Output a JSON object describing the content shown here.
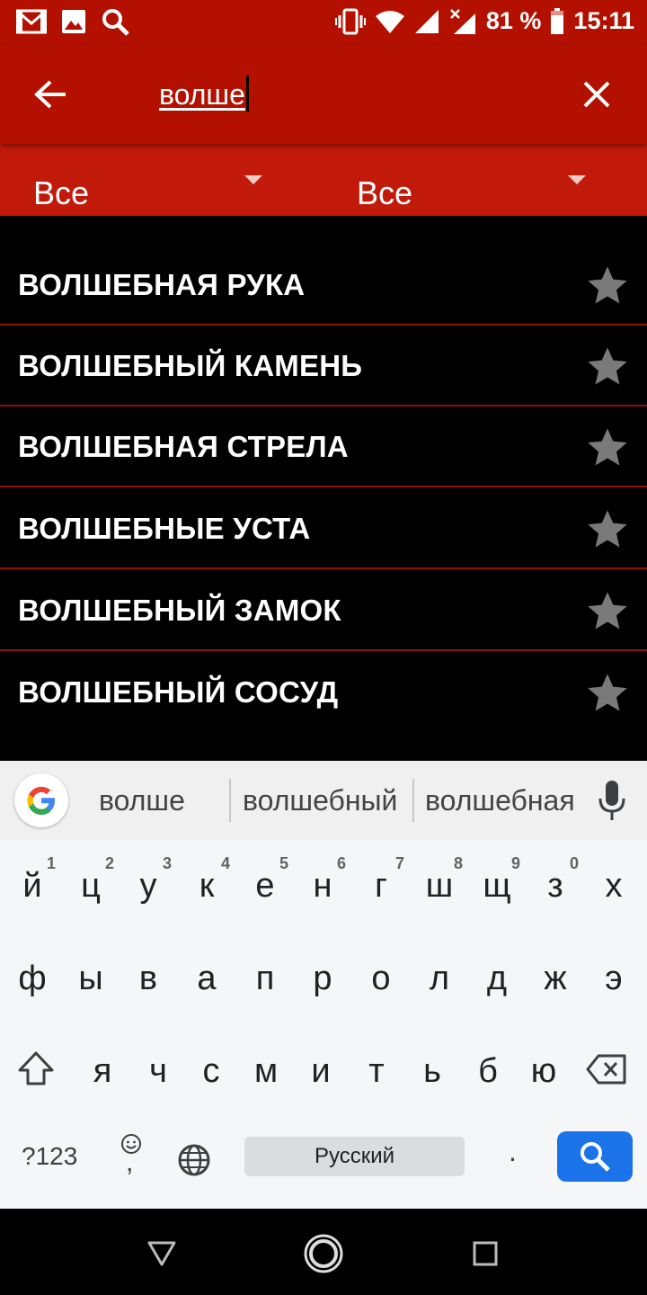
{
  "status_bar": {
    "battery": "81 %",
    "time": "15:11",
    "icons": [
      "gmail-icon",
      "gallery-icon",
      "search-icon",
      "vibrate-icon",
      "wifi-icon",
      "signal-icon",
      "signal-nodata-icon",
      "battery-icon"
    ]
  },
  "toolbar": {
    "back_icon": "arrow-back-icon",
    "query": "волше",
    "clear_icon": "close-icon"
  },
  "filters": [
    {
      "label": "Все"
    },
    {
      "label": "Все"
    }
  ],
  "results": [
    {
      "label": "ВОЛШЕБНАЯ РУКА",
      "favorite": false
    },
    {
      "label": "ВОЛШЕБНЫЙ КАМЕНЬ",
      "favorite": false
    },
    {
      "label": "ВОЛШЕБНАЯ СТРЕЛА",
      "favorite": false
    },
    {
      "label": "ВОЛШЕБНЫЕ УСТА",
      "favorite": false
    },
    {
      "label": "ВОЛШЕБНЫЙ ЗАМОК",
      "favorite": false
    },
    {
      "label": "ВОЛШЕБНЫЙ СОСУД",
      "favorite": false
    }
  ],
  "colors": {
    "toolbar": "#b31000",
    "filters": "#c11a0b",
    "divider": "#8a120b",
    "star": "#7a7a7a",
    "search_key": "#1a73e8"
  },
  "keyboard": {
    "suggestions": [
      "волше",
      "волшебный",
      "волшебная"
    ],
    "row1": [
      {
        "ch": "й",
        "hint": "1"
      },
      {
        "ch": "ц",
        "hint": "2"
      },
      {
        "ch": "у",
        "hint": "3"
      },
      {
        "ch": "к",
        "hint": "4"
      },
      {
        "ch": "е",
        "hint": "5"
      },
      {
        "ch": "н",
        "hint": "6"
      },
      {
        "ch": "г",
        "hint": "7"
      },
      {
        "ch": "ш",
        "hint": "8"
      },
      {
        "ch": "щ",
        "hint": "9"
      },
      {
        "ch": "з",
        "hint": "0"
      },
      {
        "ch": "х",
        "hint": ""
      }
    ],
    "row2": [
      "ф",
      "ы",
      "в",
      "а",
      "п",
      "р",
      "о",
      "л",
      "д",
      "ж",
      "э"
    ],
    "row3": [
      "я",
      "ч",
      "с",
      "м",
      "и",
      "т",
      "ь",
      "б",
      "ю"
    ],
    "symbols_label": "?123",
    "comma": ",",
    "period": ".",
    "space_label": "Русский"
  },
  "navbar": {
    "icons": [
      "nav-back-icon",
      "nav-home-icon",
      "nav-recents-icon"
    ]
  }
}
